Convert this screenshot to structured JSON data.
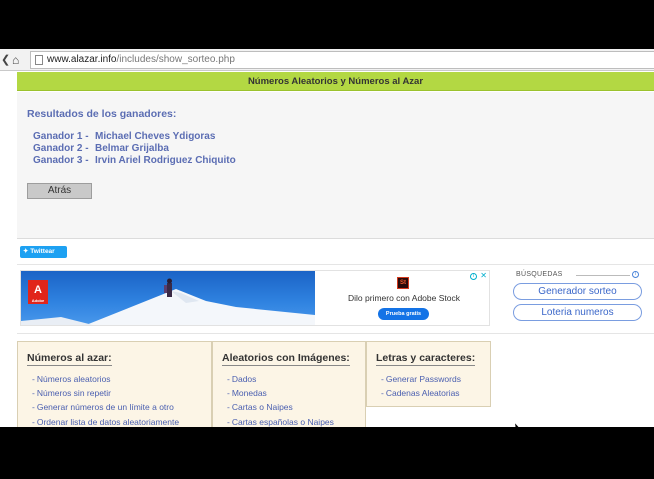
{
  "browser": {
    "url_host": "www.alazar.info",
    "url_path": "/includes/show_sorteo.php",
    "back_icon": "back-arrow-icon",
    "home_icon": "home-icon",
    "page_icon": "page-icon"
  },
  "header": {
    "title": "Números Aleatorios y Números al Azar",
    "accent_color": "#b3d843"
  },
  "results": {
    "title": "Resultados de los ganadores:",
    "winners": [
      {
        "label": "Ganador 1 -",
        "name": "Michael Cheves Ydigoras"
      },
      {
        "label": "Ganador 2 -",
        "name": "Belmar Grijalba"
      },
      {
        "label": "Ganador 3 -",
        "name": "Irvin Ariel Rodriguez Chiquito"
      }
    ],
    "back_button": "Atrás"
  },
  "social": {
    "twitter_label": "Twittear",
    "twitter_color": "#1da1f2"
  },
  "ad": {
    "logo_text": "Adobe",
    "stock_logo": "St",
    "headline": "Dilo primero con Adobe Stock",
    "cta": "Prueba gratis"
  },
  "searches": {
    "title": "BÚSQUEDAS",
    "links": [
      "Generador sorteo",
      "Loteria numeros"
    ]
  },
  "categories": [
    {
      "title": "Números al azar:",
      "items": [
        "Números aleatorios",
        "Números sin repetir",
        "Generar números de un límite a otro",
        "Ordenar lista de datos aleatoriamente"
      ]
    },
    {
      "title": "Aleatorios con Imágenes:",
      "items": [
        "Dados",
        "Monedas",
        "Cartas o Naipes",
        "Cartas españolas o Naipes"
      ]
    },
    {
      "title": "Letras y caracteres:",
      "items": [
        "Generar Passwords",
        "Cadenas Aleatorias"
      ]
    }
  ],
  "colors": {
    "link": "#4a5fb0",
    "category_bg": "#fcf5e6"
  }
}
